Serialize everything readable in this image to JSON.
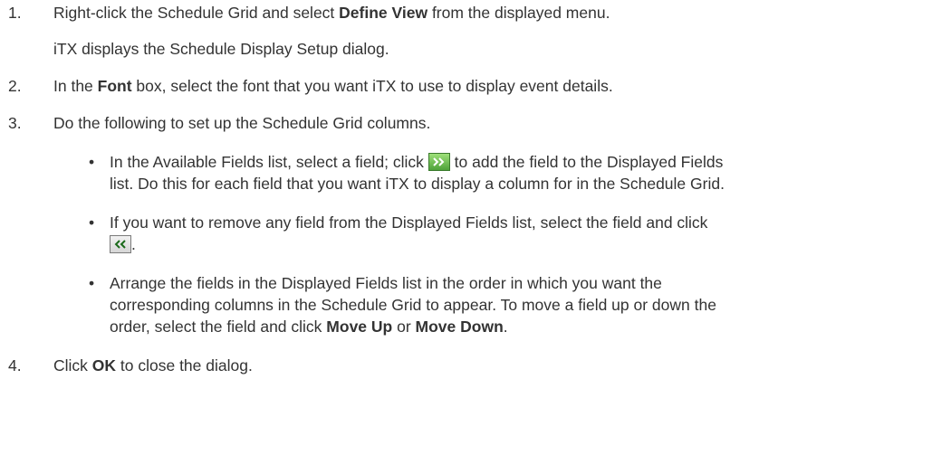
{
  "steps": [
    {
      "number": "1.",
      "pre": "Right-click the Schedule Grid and select ",
      "bold": "Define View",
      "post": " from the displayed menu.",
      "note": "iTX displays the Schedule Display Setup dialog."
    },
    {
      "number": "2.",
      "pre": "In the ",
      "bold": "Font",
      "post": " box, select the font that you want iTX to use to display event details."
    },
    {
      "number": "3.",
      "text": "Do the following to set up the Schedule Grid columns.",
      "bullets": [
        {
          "line1_pre": "In the Available Fields list, select a field; click ",
          "icon": "add-arrows-icon",
          "line1_post": " to add the field to the Displayed Fields",
          "line2": "list. Do this for each field that you want iTX to display a column for in the Schedule Grid."
        },
        {
          "line1": "If you want to remove any field from the Displayed Fields list, select the field and click",
          "icon": "remove-arrows-icon",
          "line2_post": "."
        },
        {
          "line1": "Arrange the fields in the Displayed Fields list in the order in which you want the",
          "line2": "corresponding columns in the Schedule Grid to appear. To move a field up or down the",
          "line3_pre": "order, select the field and click ",
          "bold1": "Move Up",
          "mid": " or ",
          "bold2": "Move Down",
          "line3_post": "."
        }
      ]
    },
    {
      "number": "4.",
      "pre": "Click ",
      "bold": "OK",
      "post": " to close the dialog."
    }
  ],
  "colors": {
    "text": "#333333",
    "add_button": "#4fa23a",
    "remove_button": "#d6d6d6"
  }
}
